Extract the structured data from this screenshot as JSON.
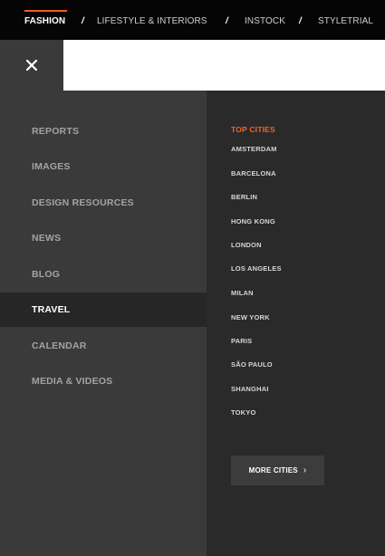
{
  "topnav": {
    "items": [
      "FASHION",
      "LIFESTYLE & INTERIORS",
      "INSTOCK",
      "STYLETRIAL"
    ],
    "separator": "/",
    "active_index": 0,
    "accent_color": "#f25c22"
  },
  "close_icon": "close-icon",
  "menu": {
    "items": [
      "REPORTS",
      "IMAGES",
      "DESIGN RESOURCES",
      "NEWS",
      "BLOG",
      "TRAVEL",
      "CALENDAR",
      "MEDIA & VIDEOS"
    ],
    "active_index": 5
  },
  "cities": {
    "heading": "TOP CITIES",
    "items": [
      "AMSTERDAM",
      "BARCELONA",
      "BERLIN",
      "HONG KONG",
      "LONDON",
      "LOS ANGELES",
      "MILAN",
      "NEW YORK",
      "PARIS",
      "SÃO PAULO",
      "SHANGHAI",
      "TOKYO"
    ],
    "more_label": "MORE CITIES",
    "more_icon": "chevron-right-icon",
    "heading_color": "#f26522"
  }
}
